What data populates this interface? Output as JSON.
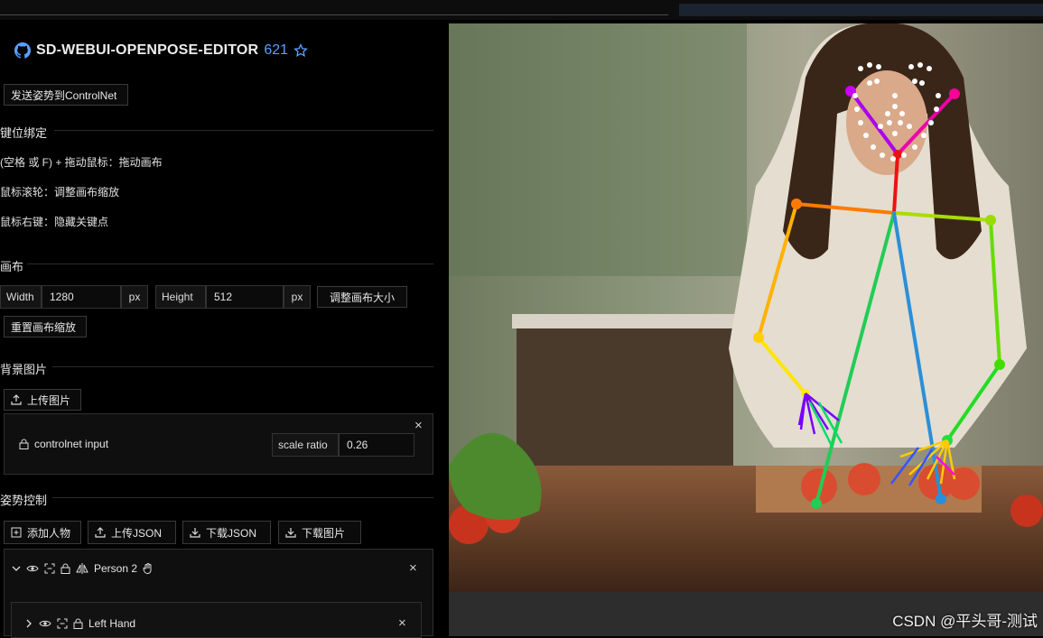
{
  "header": {
    "title": "SD-WEBUI-OPENPOSE-EDITOR",
    "stars": "621",
    "send_button": "发送姿势到ControlNet"
  },
  "keybindings": {
    "heading": "键位绑定",
    "hints": [
      "(空格 或 F) + 拖动鼠标：拖动画布",
      "鼠标滚轮：调整画布缩放",
      "鼠标右键：隐藏关键点"
    ]
  },
  "canvas": {
    "heading": "画布",
    "width_label": "Width",
    "width_value": "1280",
    "height_label": "Height",
    "height_value": "512",
    "unit": "px",
    "resize_button": "调整画布大小",
    "reset_zoom_button": "重置画布缩放"
  },
  "background": {
    "heading": "背景图片",
    "upload_button": "上传图片",
    "input_label": "controlnet input",
    "scale_label": "scale ratio",
    "scale_value": "0.26",
    "close_symbol": "×"
  },
  "pose": {
    "heading": "姿势控制",
    "add_person_button": "添加人物",
    "upload_json_button": "上传JSON",
    "download_json_button": "下载JSON",
    "download_image_button": "下载图片",
    "person_label": "Person 2",
    "left_hand_label": "Left Hand",
    "close_symbol": "×"
  },
  "watermark": "CSDN @平头哥-测试",
  "icons": [
    "github-icon",
    "star-icon",
    "upload-icon",
    "download-icon",
    "add-icon",
    "lock-icon",
    "eye-icon",
    "focus-icon",
    "mirror-icon",
    "hand-icon",
    "chevron-down-icon",
    "chevron-right-icon",
    "close-icon"
  ],
  "colors": {
    "accent": "#5aa0ff",
    "panel_bg": "#000000",
    "card_bg": "#0f0f0f"
  }
}
